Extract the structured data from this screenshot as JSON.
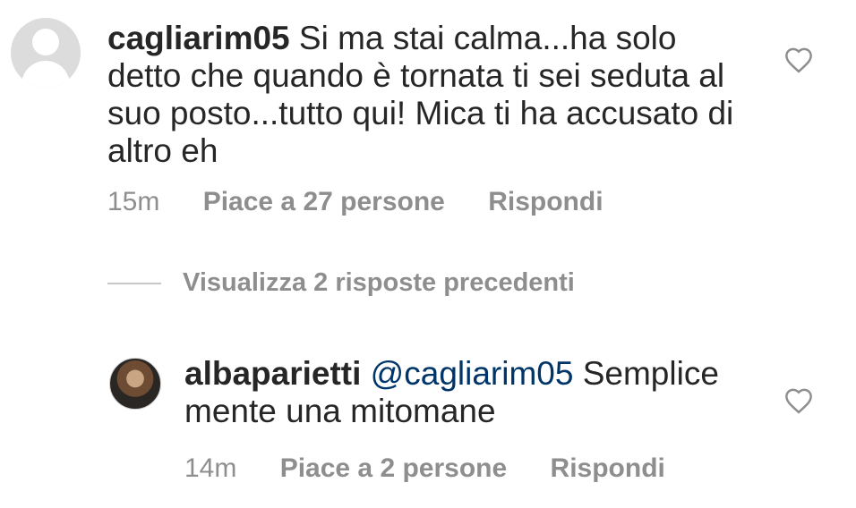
{
  "comments": [
    {
      "username": "cagliarim05",
      "text": " Si ma stai calma...ha solo detto che quando è tornata ti sei seduta al suo posto...tutto qui! Mica ti ha accusato di altro eh",
      "time": "15m",
      "likes": "Piace a 27 persone",
      "reply_label": "Rispondi",
      "avatar_icon": "default-avatar-icon",
      "like_icon": "heart-outline-icon"
    },
    {
      "username": "albaparietti",
      "mention": " @cagliarim05",
      "text": " Semplice mente una mitomane",
      "time": "14m",
      "likes": "Piace a 2 persone",
      "reply_label": "Rispondi",
      "avatar_icon": "profile-photo-avatar",
      "like_icon": "heart-outline-icon"
    }
  ],
  "view_replies": "Visualizza 2 risposte precedenti",
  "colors": {
    "text": "#262626",
    "secondary": "#8e8e8e",
    "mention": "#003569",
    "avatar_placeholder": "#dcdcdc"
  }
}
